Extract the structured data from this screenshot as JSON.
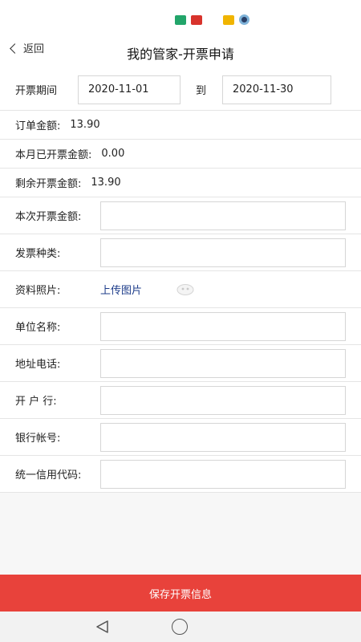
{
  "nav": {
    "back_label": "返回",
    "title": "我的管家-开票申请"
  },
  "invoice_period": {
    "label": "开票期间",
    "from": "2020-11-01",
    "to_label": "到",
    "to": "2020-11-30"
  },
  "order_amount": {
    "label": "订单金额:",
    "value": "13.90"
  },
  "invoiced_this_month": {
    "label": "本月已开票金额:",
    "value": "0.00"
  },
  "remaining_amount": {
    "label": "剩余开票金额:",
    "value": "13.90"
  },
  "fields": {
    "invoice_amount": {
      "label": "本次开票金额:",
      "value": ""
    },
    "invoice_type": {
      "label": "发票种类:",
      "value": ""
    },
    "photo": {
      "label": "资料照片:",
      "upload_label": "上传图片"
    },
    "company_name": {
      "label": "单位名称:",
      "value": ""
    },
    "address_phone": {
      "label": "地址电话:",
      "value": ""
    },
    "bank": {
      "label": "开 户 行:",
      "value": ""
    },
    "bank_account": {
      "label": "银行帐号:",
      "value": ""
    },
    "credit_code": {
      "label": "统一信用代码:",
      "value": ""
    }
  },
  "save_button": {
    "label": "保存开票信息"
  },
  "colors": {
    "accent": "#e8423b",
    "link": "#1d3c8a"
  }
}
